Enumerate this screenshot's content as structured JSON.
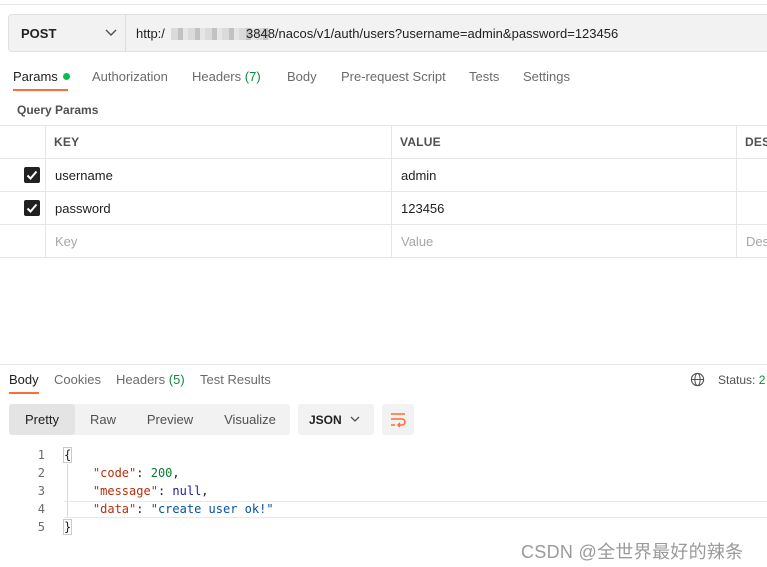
{
  "request": {
    "method": "POST",
    "url_prefix": "http:/",
    "url_suffix": "3848/nacos/v1/auth/users?username=admin&password=123456"
  },
  "request_tabs": [
    {
      "label": "Params"
    },
    {
      "label": "Authorization"
    },
    {
      "label": "Headers",
      "count": "(7)"
    },
    {
      "label": "Body"
    },
    {
      "label": "Pre-request Script"
    },
    {
      "label": "Tests"
    },
    {
      "label": "Settings"
    }
  ],
  "query_params": {
    "title": "Query Params",
    "columns": {
      "key": "KEY",
      "value": "VALUE",
      "desc": "DES"
    },
    "rows": [
      {
        "key": "username",
        "value": "admin",
        "checked": true
      },
      {
        "key": "password",
        "value": "123456",
        "checked": true
      }
    ],
    "placeholder": {
      "key": "Key",
      "value": "Value",
      "desc": "Des"
    }
  },
  "response_tabs": [
    {
      "label": "Body"
    },
    {
      "label": "Cookies"
    },
    {
      "label": "Headers",
      "count": "(5)"
    },
    {
      "label": "Test Results"
    }
  ],
  "status": {
    "label": "Status:",
    "code": "2"
  },
  "view_modes": [
    "Pretty",
    "Raw",
    "Preview",
    "Visualize"
  ],
  "format": "JSON",
  "code_lines": {
    "n1": "1",
    "n2": "2",
    "n3": "3",
    "n4": "4",
    "n5": "5",
    "open": "{",
    "k1": "\"code\"",
    "v1": "200",
    "k2": "\"message\"",
    "v2": "null",
    "k3": "\"data\"",
    "v3": "\"create user ok!\"",
    "close": "}"
  },
  "watermark": "CSDN @全世界最好的辣条",
  "colors": {
    "accent": "#ff6c37",
    "success": "#0c8a3e"
  }
}
